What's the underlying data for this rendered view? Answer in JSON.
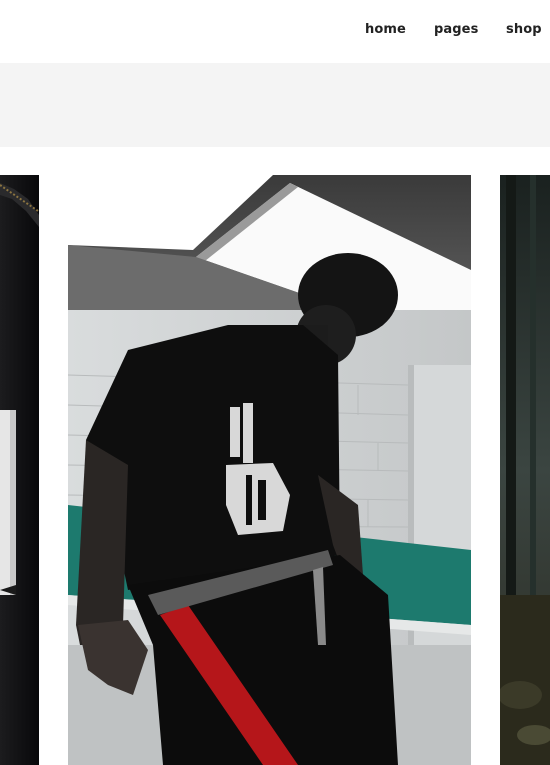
{
  "nav": {
    "items": [
      {
        "label": "home"
      },
      {
        "label": "pages"
      },
      {
        "label": "shop"
      }
    ]
  },
  "slides": [
    {
      "position": "previous-partial"
    },
    {
      "position": "current"
    },
    {
      "position": "next-partial"
    }
  ]
}
